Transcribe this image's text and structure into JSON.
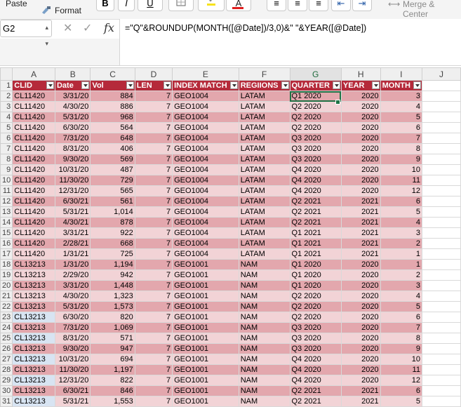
{
  "ribbon": {
    "paste_label": "Paste",
    "format_label": "Format",
    "bold": "B",
    "italic": "I",
    "underline": "U",
    "font_color_glyph": "A",
    "merge_center_label": "Merge & Center",
    "highlight_color": "#f7e21c",
    "font_color": "#e02020"
  },
  "formula_bar": {
    "name_box": "G2",
    "formula": "=\"Q\"&ROUNDUP(MONTH([@Date])/3,0)&\" \"&YEAR([@Date])"
  },
  "columns": [
    "A",
    "B",
    "C",
    "D",
    "E",
    "F",
    "G",
    "H",
    "I",
    "J"
  ],
  "table_headers": [
    "CLID",
    "Date",
    "Vol",
    "LEN",
    "INDEX MATCH",
    "REGIIONS",
    "QUARTER",
    "YEAR",
    "MONTH"
  ],
  "rows": [
    {
      "num": "2",
      "clid": "CL11420",
      "date": "3/31/20",
      "vol": "884",
      "len": "7",
      "idx": "GEO1004",
      "region": "LATAM",
      "quarter": "Q1 2020",
      "year": "2020",
      "month": "3"
    },
    {
      "num": "3",
      "clid": "CL11420",
      "date": "4/30/20",
      "vol": "886",
      "len": "7",
      "idx": "GEO1004",
      "region": "LATAM",
      "quarter": "Q2 2020",
      "year": "2020",
      "month": "4"
    },
    {
      "num": "4",
      "clid": "CL11420",
      "date": "5/31/20",
      "vol": "968",
      "len": "7",
      "idx": "GEO1004",
      "region": "LATAM",
      "quarter": "Q2 2020",
      "year": "2020",
      "month": "5"
    },
    {
      "num": "5",
      "clid": "CL11420",
      "date": "6/30/20",
      "vol": "564",
      "len": "7",
      "idx": "GEO1004",
      "region": "LATAM",
      "quarter": "Q2 2020",
      "year": "2020",
      "month": "6"
    },
    {
      "num": "6",
      "clid": "CL11420",
      "date": "7/31/20",
      "vol": "648",
      "len": "7",
      "idx": "GEO1004",
      "region": "LATAM",
      "quarter": "Q3 2020",
      "year": "2020",
      "month": "7"
    },
    {
      "num": "7",
      "clid": "CL11420",
      "date": "8/31/20",
      "vol": "406",
      "len": "7",
      "idx": "GEO1004",
      "region": "LATAM",
      "quarter": "Q3 2020",
      "year": "2020",
      "month": "8"
    },
    {
      "num": "8",
      "clid": "CL11420",
      "date": "9/30/20",
      "vol": "569",
      "len": "7",
      "idx": "GEO1004",
      "region": "LATAM",
      "quarter": "Q3 2020",
      "year": "2020",
      "month": "9"
    },
    {
      "num": "9",
      "clid": "CL11420",
      "date": "10/31/20",
      "vol": "487",
      "len": "7",
      "idx": "GEO1004",
      "region": "LATAM",
      "quarter": "Q4 2020",
      "year": "2020",
      "month": "10"
    },
    {
      "num": "10",
      "clid": "CL11420",
      "date": "11/30/20",
      "vol": "729",
      "len": "7",
      "idx": "GEO1004",
      "region": "LATAM",
      "quarter": "Q4 2020",
      "year": "2020",
      "month": "11"
    },
    {
      "num": "11",
      "clid": "CL11420",
      "date": "12/31/20",
      "vol": "565",
      "len": "7",
      "idx": "GEO1004",
      "region": "LATAM",
      "quarter": "Q4 2020",
      "year": "2020",
      "month": "12"
    },
    {
      "num": "12",
      "clid": "CL11420",
      "date": "6/30/21",
      "vol": "561",
      "len": "7",
      "idx": "GEO1004",
      "region": "LATAM",
      "quarter": "Q2 2021",
      "year": "2021",
      "month": "6"
    },
    {
      "num": "13",
      "clid": "CL11420",
      "date": "5/31/21",
      "vol": "1,014",
      "len": "7",
      "idx": "GEO1004",
      "region": "LATAM",
      "quarter": "Q2 2021",
      "year": "2021",
      "month": "5"
    },
    {
      "num": "14",
      "clid": "CL11420",
      "date": "4/30/21",
      "vol": "878",
      "len": "7",
      "idx": "GEO1004",
      "region": "LATAM",
      "quarter": "Q2 2021",
      "year": "2021",
      "month": "4"
    },
    {
      "num": "15",
      "clid": "CL11420",
      "date": "3/31/21",
      "vol": "922",
      "len": "7",
      "idx": "GEO1004",
      "region": "LATAM",
      "quarter": "Q1 2021",
      "year": "2021",
      "month": "3"
    },
    {
      "num": "16",
      "clid": "CL11420",
      "date": "2/28/21",
      "vol": "668",
      "len": "7",
      "idx": "GEO1004",
      "region": "LATAM",
      "quarter": "Q1 2021",
      "year": "2021",
      "month": "2"
    },
    {
      "num": "17",
      "clid": "CL11420",
      "date": "1/31/21",
      "vol": "725",
      "len": "7",
      "idx": "GEO1004",
      "region": "LATAM",
      "quarter": "Q1 2021",
      "year": "2021",
      "month": "1"
    },
    {
      "num": "18",
      "clid": "CL13213",
      "date": "1/31/20",
      "vol": "1,194",
      "len": "7",
      "idx": "GEO1001",
      "region": "NAM",
      "quarter": "Q1 2020",
      "year": "2020",
      "month": "1"
    },
    {
      "num": "19",
      "clid": "CL13213",
      "date": "2/29/20",
      "vol": "942",
      "len": "7",
      "idx": "GEO1001",
      "region": "NAM",
      "quarter": "Q1 2020",
      "year": "2020",
      "month": "2"
    },
    {
      "num": "20",
      "clid": "CL13213",
      "date": "3/31/20",
      "vol": "1,448",
      "len": "7",
      "idx": "GEO1001",
      "region": "NAM",
      "quarter": "Q1 2020",
      "year": "2020",
      "month": "3"
    },
    {
      "num": "21",
      "clid": "CL13213",
      "date": "4/30/20",
      "vol": "1,323",
      "len": "7",
      "idx": "GEO1001",
      "region": "NAM",
      "quarter": "Q2 2020",
      "year": "2020",
      "month": "4"
    },
    {
      "num": "22",
      "clid": "CL13213",
      "date": "5/31/20",
      "vol": "1,573",
      "len": "7",
      "idx": "GEO1001",
      "region": "NAM",
      "quarter": "Q2 2020",
      "year": "2020",
      "month": "5"
    },
    {
      "num": "23",
      "clid": "CL13213",
      "date": "6/30/20",
      "vol": "820",
      "len": "7",
      "idx": "GEO1001",
      "region": "NAM",
      "quarter": "Q2 2020",
      "year": "2020",
      "month": "6"
    },
    {
      "num": "24",
      "clid": "CL13213",
      "date": "7/31/20",
      "vol": "1,069",
      "len": "7",
      "idx": "GEO1001",
      "region": "NAM",
      "quarter": "Q3 2020",
      "year": "2020",
      "month": "7"
    },
    {
      "num": "25",
      "clid": "CL13213",
      "date": "8/31/20",
      "vol": "571",
      "len": "7",
      "idx": "GEO1001",
      "region": "NAM",
      "quarter": "Q3 2020",
      "year": "2020",
      "month": "8"
    },
    {
      "num": "26",
      "clid": "CL13213",
      "date": "9/30/20",
      "vol": "947",
      "len": "7",
      "idx": "GEO1001",
      "region": "NAM",
      "quarter": "Q3 2020",
      "year": "2020",
      "month": "9"
    },
    {
      "num": "27",
      "clid": "CL13213",
      "date": "10/31/20",
      "vol": "694",
      "len": "7",
      "idx": "GEO1001",
      "region": "NAM",
      "quarter": "Q4 2020",
      "year": "2020",
      "month": "10"
    },
    {
      "num": "28",
      "clid": "CL13213",
      "date": "11/30/20",
      "vol": "1,197",
      "len": "7",
      "idx": "GEO1001",
      "region": "NAM",
      "quarter": "Q4 2020",
      "year": "2020",
      "month": "11"
    },
    {
      "num": "29",
      "clid": "CL13213",
      "date": "12/31/20",
      "vol": "822",
      "len": "7",
      "idx": "GEO1001",
      "region": "NAM",
      "quarter": "Q4 2020",
      "year": "2020",
      "month": "12"
    },
    {
      "num": "30",
      "clid": "CL13213",
      "date": "6/30/21",
      "vol": "846",
      "len": "7",
      "idx": "GEO1001",
      "region": "NAM",
      "quarter": "Q2 2021",
      "year": "2021",
      "month": "6"
    },
    {
      "num": "31",
      "clid": "CL13213",
      "date": "5/31/21",
      "vol": "1,553",
      "len": "7",
      "idx": "GEO1001",
      "region": "NAM",
      "quarter": "Q2 2021",
      "year": "2021",
      "month": "5"
    }
  ]
}
